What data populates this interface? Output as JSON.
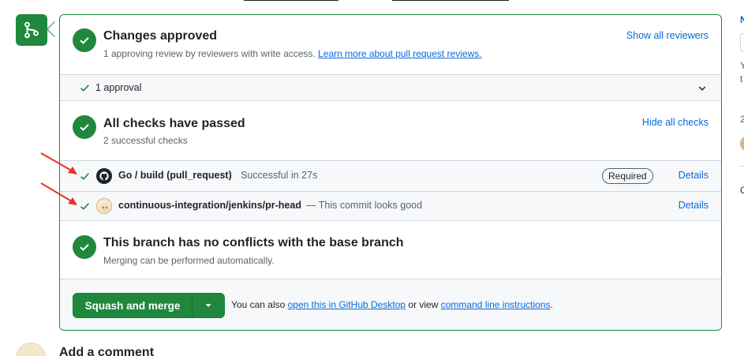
{
  "approved": {
    "title": "Changes approved",
    "description": "1 approving review by reviewers with write access.",
    "learn_link": "Learn more about pull request reviews.",
    "show_reviewers": "Show all reviewers"
  },
  "approval_row": {
    "label": "1 approval"
  },
  "checks": {
    "title": "All checks have passed",
    "subtitle": "2 successful checks",
    "hide_link": "Hide all checks",
    "items": [
      {
        "name": "Go / build (pull_request)",
        "status": "Successful in 27s",
        "badge": "Required",
        "details": "Details",
        "icon": "github-icon"
      },
      {
        "name": "continuous-integration/jenkins/pr-head",
        "status": "— This commit looks good",
        "details": "Details",
        "icon": "jenkins-icon"
      }
    ]
  },
  "conflicts": {
    "title": "This branch has no conflicts with the base branch",
    "subtitle": "Merging can be performed automatically."
  },
  "merge": {
    "button_label": "Squash and merge",
    "note_prefix": "You can also",
    "desktop_link": "open this in GitHub Desktop",
    "note_middle": "or view",
    "cli_link": "command line instructions",
    "note_suffix": "."
  },
  "comment": {
    "title": "Add a comment"
  },
  "colors": {
    "success": "#1f883d",
    "link": "#0969da",
    "annotation": "#e8322a"
  }
}
